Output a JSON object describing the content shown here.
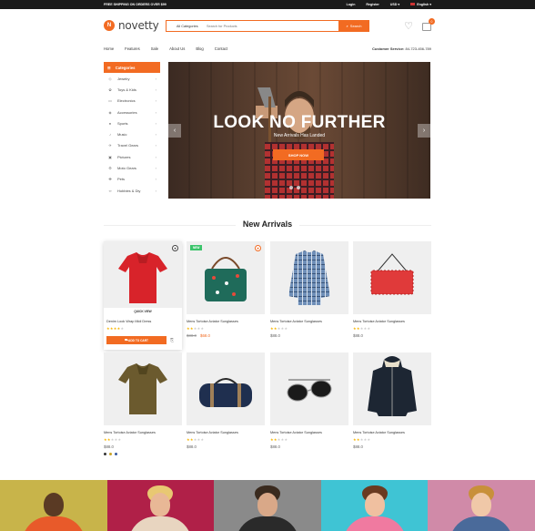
{
  "topbar": {
    "promo": "FREE SHIPPING ON ORDERS OVER $99",
    "login": "Login",
    "register": "Register",
    "currency": "USD",
    "language": "English"
  },
  "header": {
    "logo_text": "novetty",
    "logo_mark": "N",
    "search_category": "All Categories",
    "search_placeholder": "Search for Products",
    "search_button": "Search",
    "cart_count": "0",
    "wishlist_icon": "heart-icon",
    "cart_icon": "shopping-bag-icon"
  },
  "nav": {
    "items": [
      "Home",
      "Features",
      "Sale",
      "About Us",
      "Blog",
      "Contact"
    ],
    "support_label": "Customer Service:",
    "support_phone": "84-723-456-789"
  },
  "categories": {
    "title": "Categories",
    "items": [
      {
        "label": "Jewelry",
        "icon": "diamond-icon"
      },
      {
        "label": "Toys & Kids",
        "icon": "toy-icon"
      },
      {
        "label": "Electronics",
        "icon": "tv-icon"
      },
      {
        "label": "Accessories",
        "icon": "tag-icon"
      },
      {
        "label": "Sports",
        "icon": "ball-icon"
      },
      {
        "label": "Music",
        "icon": "music-icon"
      },
      {
        "label": "Travel Gears",
        "icon": "plane-icon"
      },
      {
        "label": "Pictures",
        "icon": "picture-icon"
      },
      {
        "label": "Moto Gears",
        "icon": "moto-icon"
      },
      {
        "label": "Pets",
        "icon": "paw-icon"
      },
      {
        "label": "Hobbies & Diy",
        "icon": "bike-icon"
      }
    ]
  },
  "banner": {
    "title": "LOOK NO FURTHER",
    "subtitle": "New Arrivals Has Landed",
    "button": "SHOP NOW"
  },
  "new_arrivals": {
    "title": "New Arrivals",
    "products": [
      {
        "name": "Denim Look Wrap Midi Dress",
        "rating": 4,
        "price": "",
        "quick_view": "QUICK VIEW",
        "add_to_cart": "ADD TO CART",
        "badge": "",
        "item": "red-polo-shirt"
      },
      {
        "name": "Mens Tortoise Aviator Sunglasses",
        "rating": 2,
        "old_price": "$88.0",
        "price": "$68.0",
        "badge": "NEW",
        "item": "green-dotted-bag"
      },
      {
        "name": "Mens Tortoise Aviator Sunglasses",
        "rating": 2,
        "price": "$88.0",
        "badge": "",
        "item": "plaid-shirt"
      },
      {
        "name": "Mens Tortoise Aviator Sunglasses",
        "rating": 2,
        "price": "$88.0",
        "badge": "",
        "item": "red-clutch"
      },
      {
        "name": "Mens Tortoise Aviator Sunglasses",
        "rating": 2,
        "price": "$88.0",
        "badge": "",
        "item": "olive-polo",
        "swatches": [
          "#333333",
          "#c9a227",
          "#3a5ba0"
        ]
      },
      {
        "name": "Mens Tortoise Aviator Sunglasses",
        "rating": 2,
        "price": "$88.0",
        "badge": "",
        "item": "duffel-bag"
      },
      {
        "name": "Mens Tortoise Aviator Sunglasses",
        "rating": 2,
        "price": "$88.0",
        "badge": "",
        "item": "sunglasses"
      },
      {
        "name": "Mens Tortoise Aviator Sunglasses",
        "rating": 2,
        "price": "$88.0",
        "badge": "",
        "item": "hooded-jacket"
      }
    ]
  },
  "colors": {
    "accent": "#f26b22",
    "topbar": "#1a1a1a",
    "new_badge": "#3bc46b",
    "star": "#f7b500"
  }
}
